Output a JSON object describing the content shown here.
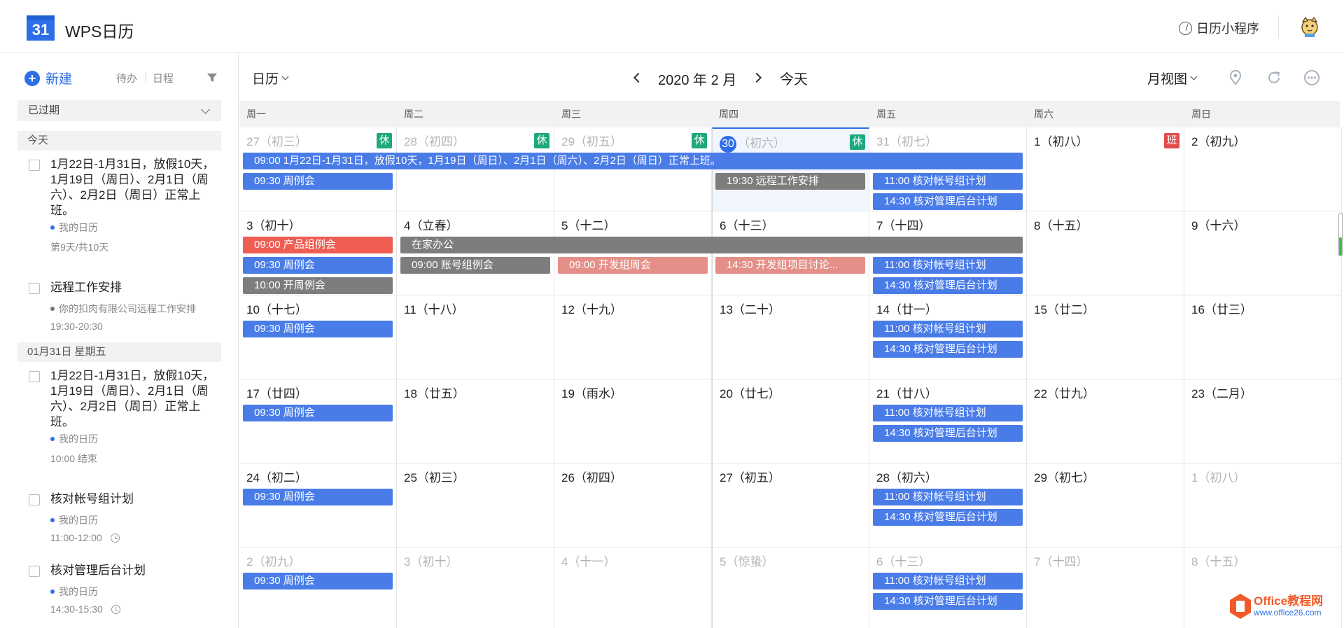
{
  "header": {
    "logo_number": "31",
    "title": "WPS日历",
    "mini_program": "日历小程序"
  },
  "sidebar": {
    "new_label": "新建",
    "tabs": [
      "待办",
      "日程"
    ],
    "expired_label": "已过期",
    "sections": [
      {
        "title": "今天",
        "items": [
          {
            "title": "1月22日-1月31日，放假10天，1月19日（周日）、2月1日（周六）、2月2日（周日）正常上班。",
            "calendar": "我的日历",
            "calendar_color": "#2e6ee6",
            "time": "第9天/共10天",
            "has_clock": false
          },
          {
            "title": "远程工作安排",
            "calendar": "你的扣肉有限公司远程工作安排",
            "calendar_color": "#777777",
            "time": "19:30-20:30",
            "has_clock": false
          }
        ]
      },
      {
        "title": "01月31日 星期五",
        "items": [
          {
            "title": "1月22日-1月31日，放假10天，1月19日（周日）、2月1日（周六）、2月2日（周日）正常上班。",
            "calendar": "我的日历",
            "calendar_color": "#2e6ee6",
            "time": "10:00 结束",
            "has_clock": false
          },
          {
            "title": "核对帐号组计划",
            "calendar": "我的日历",
            "calendar_color": "#2e6ee6",
            "time": "11:00-12:00",
            "has_clock": true
          },
          {
            "title": "核对管理后台计划",
            "calendar": "我的日历",
            "calendar_color": "#2e6ee6",
            "time": "14:30-15:30",
            "has_clock": true
          }
        ]
      }
    ]
  },
  "toolbar": {
    "calendar_select": "日历",
    "month_label": "2020 年 2 月",
    "today": "今天",
    "view_select": "月视图"
  },
  "weekdays": [
    "周一",
    "周二",
    "周三",
    "周四",
    "周五",
    "周六",
    "周日"
  ],
  "weeks": [
    [
      {
        "label": "27（初三）",
        "muted": true,
        "badge": "休",
        "badge_type": "rest"
      },
      {
        "label": "28（初四）",
        "muted": true,
        "badge": "休",
        "badge_type": "rest"
      },
      {
        "label": "29（初五）",
        "muted": true,
        "badge": "休",
        "badge_type": "rest"
      },
      {
        "label": "30",
        "suffix": "（初六）",
        "muted": true,
        "today": true,
        "badge": "休",
        "badge_type": "rest"
      },
      {
        "label": "31（初七）",
        "muted": true
      },
      {
        "label": "1（初八）",
        "badge": "班",
        "badge_type": "work"
      },
      {
        "label": "2（初九）"
      }
    ],
    [
      {
        "label": "3（初十）"
      },
      {
        "label": "4（立春）"
      },
      {
        "label": "5（十二）"
      },
      {
        "label": "6（十三）"
      },
      {
        "label": "7（十四）"
      },
      {
        "label": "8（十五）"
      },
      {
        "label": "9（十六）"
      }
    ],
    [
      {
        "label": "10（十七）"
      },
      {
        "label": "11（十八）"
      },
      {
        "label": "12（十九）"
      },
      {
        "label": "13（二十）"
      },
      {
        "label": "14（廿一）"
      },
      {
        "label": "15（廿二）"
      },
      {
        "label": "16（廿三）"
      }
    ],
    [
      {
        "label": "17（廿四）"
      },
      {
        "label": "18（廿五）"
      },
      {
        "label": "19（雨水）"
      },
      {
        "label": "20（廿七）"
      },
      {
        "label": "21（廿八）"
      },
      {
        "label": "22（廿九）"
      },
      {
        "label": "23（二月）"
      }
    ],
    [
      {
        "label": "24（初二）"
      },
      {
        "label": "25（初三）"
      },
      {
        "label": "26（初四）"
      },
      {
        "label": "27（初五）"
      },
      {
        "label": "28（初六）"
      },
      {
        "label": "29（初七）"
      },
      {
        "label": "1（初八）",
        "muted": true
      }
    ],
    [
      {
        "label": "2（初九）",
        "muted": true
      },
      {
        "label": "3（初十）",
        "muted": true
      },
      {
        "label": "4（十一）",
        "muted": true
      },
      {
        "label": "5（惊蛰）",
        "muted": true
      },
      {
        "label": "6（十三）",
        "muted": true
      },
      {
        "label": "7（十四）",
        "muted": true
      },
      {
        "label": "8（十五）",
        "muted": true
      }
    ]
  ],
  "events": [
    {
      "week": 0,
      "day": 0,
      "span": 5,
      "slot": 0,
      "color": "blue",
      "text": "09:00 1月22日-1月31日，放假10天，1月19日（周日）、2月1日（周六）、2月2日（周日）正常上班。"
    },
    {
      "week": 0,
      "day": 0,
      "span": 1,
      "slot": 1,
      "color": "blue",
      "text": "09:30 周例会"
    },
    {
      "week": 0,
      "day": 3,
      "span": 1,
      "slot": 1,
      "color": "gray",
      "text": "19:30 远程工作安排"
    },
    {
      "week": 0,
      "day": 4,
      "span": 1,
      "slot": 1,
      "color": "blue",
      "text": "11:00 核对帐号组计划"
    },
    {
      "week": 0,
      "day": 4,
      "span": 1,
      "slot": 2,
      "color": "blue",
      "text": "14:30 核对管理后台计划"
    },
    {
      "week": 1,
      "day": 0,
      "span": 1,
      "slot": 0,
      "color": "red",
      "text": "09:00 产品组例会"
    },
    {
      "week": 1,
      "day": 1,
      "span": 4,
      "slot": 0,
      "color": "gray",
      "text": "在家办公"
    },
    {
      "week": 1,
      "day": 0,
      "span": 1,
      "slot": 1,
      "color": "blue",
      "text": "09:30 周例会"
    },
    {
      "week": 1,
      "day": 1,
      "span": 1,
      "slot": 1,
      "color": "gray",
      "text": "09:00 账号组例会"
    },
    {
      "week": 1,
      "day": 2,
      "span": 1,
      "slot": 1,
      "color": "salmon",
      "text": "09:00 开发组周会"
    },
    {
      "week": 1,
      "day": 3,
      "span": 1,
      "slot": 1,
      "color": "salmon",
      "text": "14:30 开发组项目讨论..."
    },
    {
      "week": 1,
      "day": 4,
      "span": 1,
      "slot": 1,
      "color": "blue",
      "text": "11:00 核对帐号组计划"
    },
    {
      "week": 1,
      "day": 0,
      "span": 1,
      "slot": 2,
      "color": "gray",
      "text": "10:00 开周例会"
    },
    {
      "week": 1,
      "day": 4,
      "span": 1,
      "slot": 2,
      "color": "blue",
      "text": "14:30 核对管理后台计划"
    },
    {
      "week": 2,
      "day": 0,
      "span": 1,
      "slot": 0,
      "color": "blue",
      "text": "09:30 周例会"
    },
    {
      "week": 2,
      "day": 4,
      "span": 1,
      "slot": 0,
      "color": "blue",
      "text": "11:00 核对帐号组计划"
    },
    {
      "week": 2,
      "day": 4,
      "span": 1,
      "slot": 1,
      "color": "blue",
      "text": "14:30 核对管理后台计划"
    },
    {
      "week": 3,
      "day": 0,
      "span": 1,
      "slot": 0,
      "color": "blue",
      "text": "09:30 周例会"
    },
    {
      "week": 3,
      "day": 4,
      "span": 1,
      "slot": 0,
      "color": "blue",
      "text": "11:00 核对帐号组计划"
    },
    {
      "week": 3,
      "day": 4,
      "span": 1,
      "slot": 1,
      "color": "blue",
      "text": "14:30 核对管理后台计划"
    },
    {
      "week": 4,
      "day": 0,
      "span": 1,
      "slot": 0,
      "color": "blue",
      "text": "09:30 周例会"
    },
    {
      "week": 4,
      "day": 4,
      "span": 1,
      "slot": 0,
      "color": "blue",
      "text": "11:00 核对帐号组计划"
    },
    {
      "week": 4,
      "day": 4,
      "span": 1,
      "slot": 1,
      "color": "blue",
      "text": "14:30 核对管理后台计划"
    },
    {
      "week": 5,
      "day": 0,
      "span": 1,
      "slot": 0,
      "color": "blue",
      "text": "09:30 周例会"
    },
    {
      "week": 5,
      "day": 4,
      "span": 1,
      "slot": 0,
      "color": "blue",
      "text": "11:00 核对帐号组计划"
    },
    {
      "week": 5,
      "day": 4,
      "span": 1,
      "slot": 1,
      "color": "blue",
      "text": "14:30 核对管理后台计划"
    }
  ],
  "watermark": {
    "title": "Office教程网",
    "url": "www.office26.com"
  }
}
